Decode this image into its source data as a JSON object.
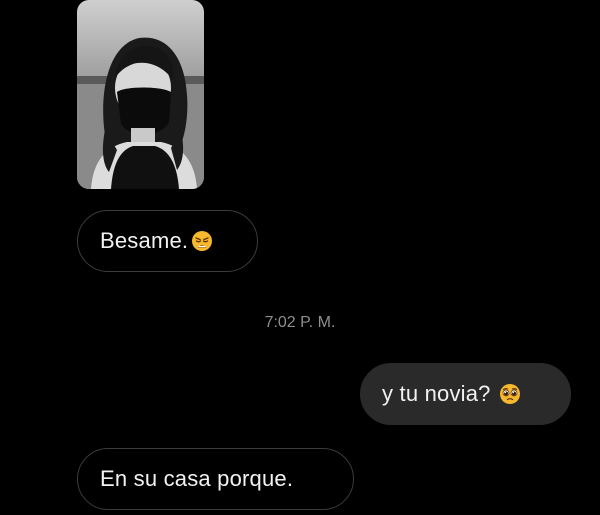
{
  "messages": [
    {
      "type": "image",
      "direction": "received"
    },
    {
      "type": "text",
      "direction": "received",
      "text": "Besame.",
      "emoji": "weary-face-icon"
    },
    {
      "type": "text",
      "direction": "sent",
      "text": "y tu novia?",
      "emoji": "pleading-face-icon"
    },
    {
      "type": "text",
      "direction": "received",
      "text": "En su casa porque."
    }
  ],
  "timestamp": "7:02 P. M.",
  "colors": {
    "background": "#000000",
    "received_border": "#3c3c3c",
    "sent_bubble": "#2a2a2a",
    "text": "#f2f2f2",
    "timestamp": "#8e8e8e",
    "emoji_yellow": "#f5b82e"
  }
}
